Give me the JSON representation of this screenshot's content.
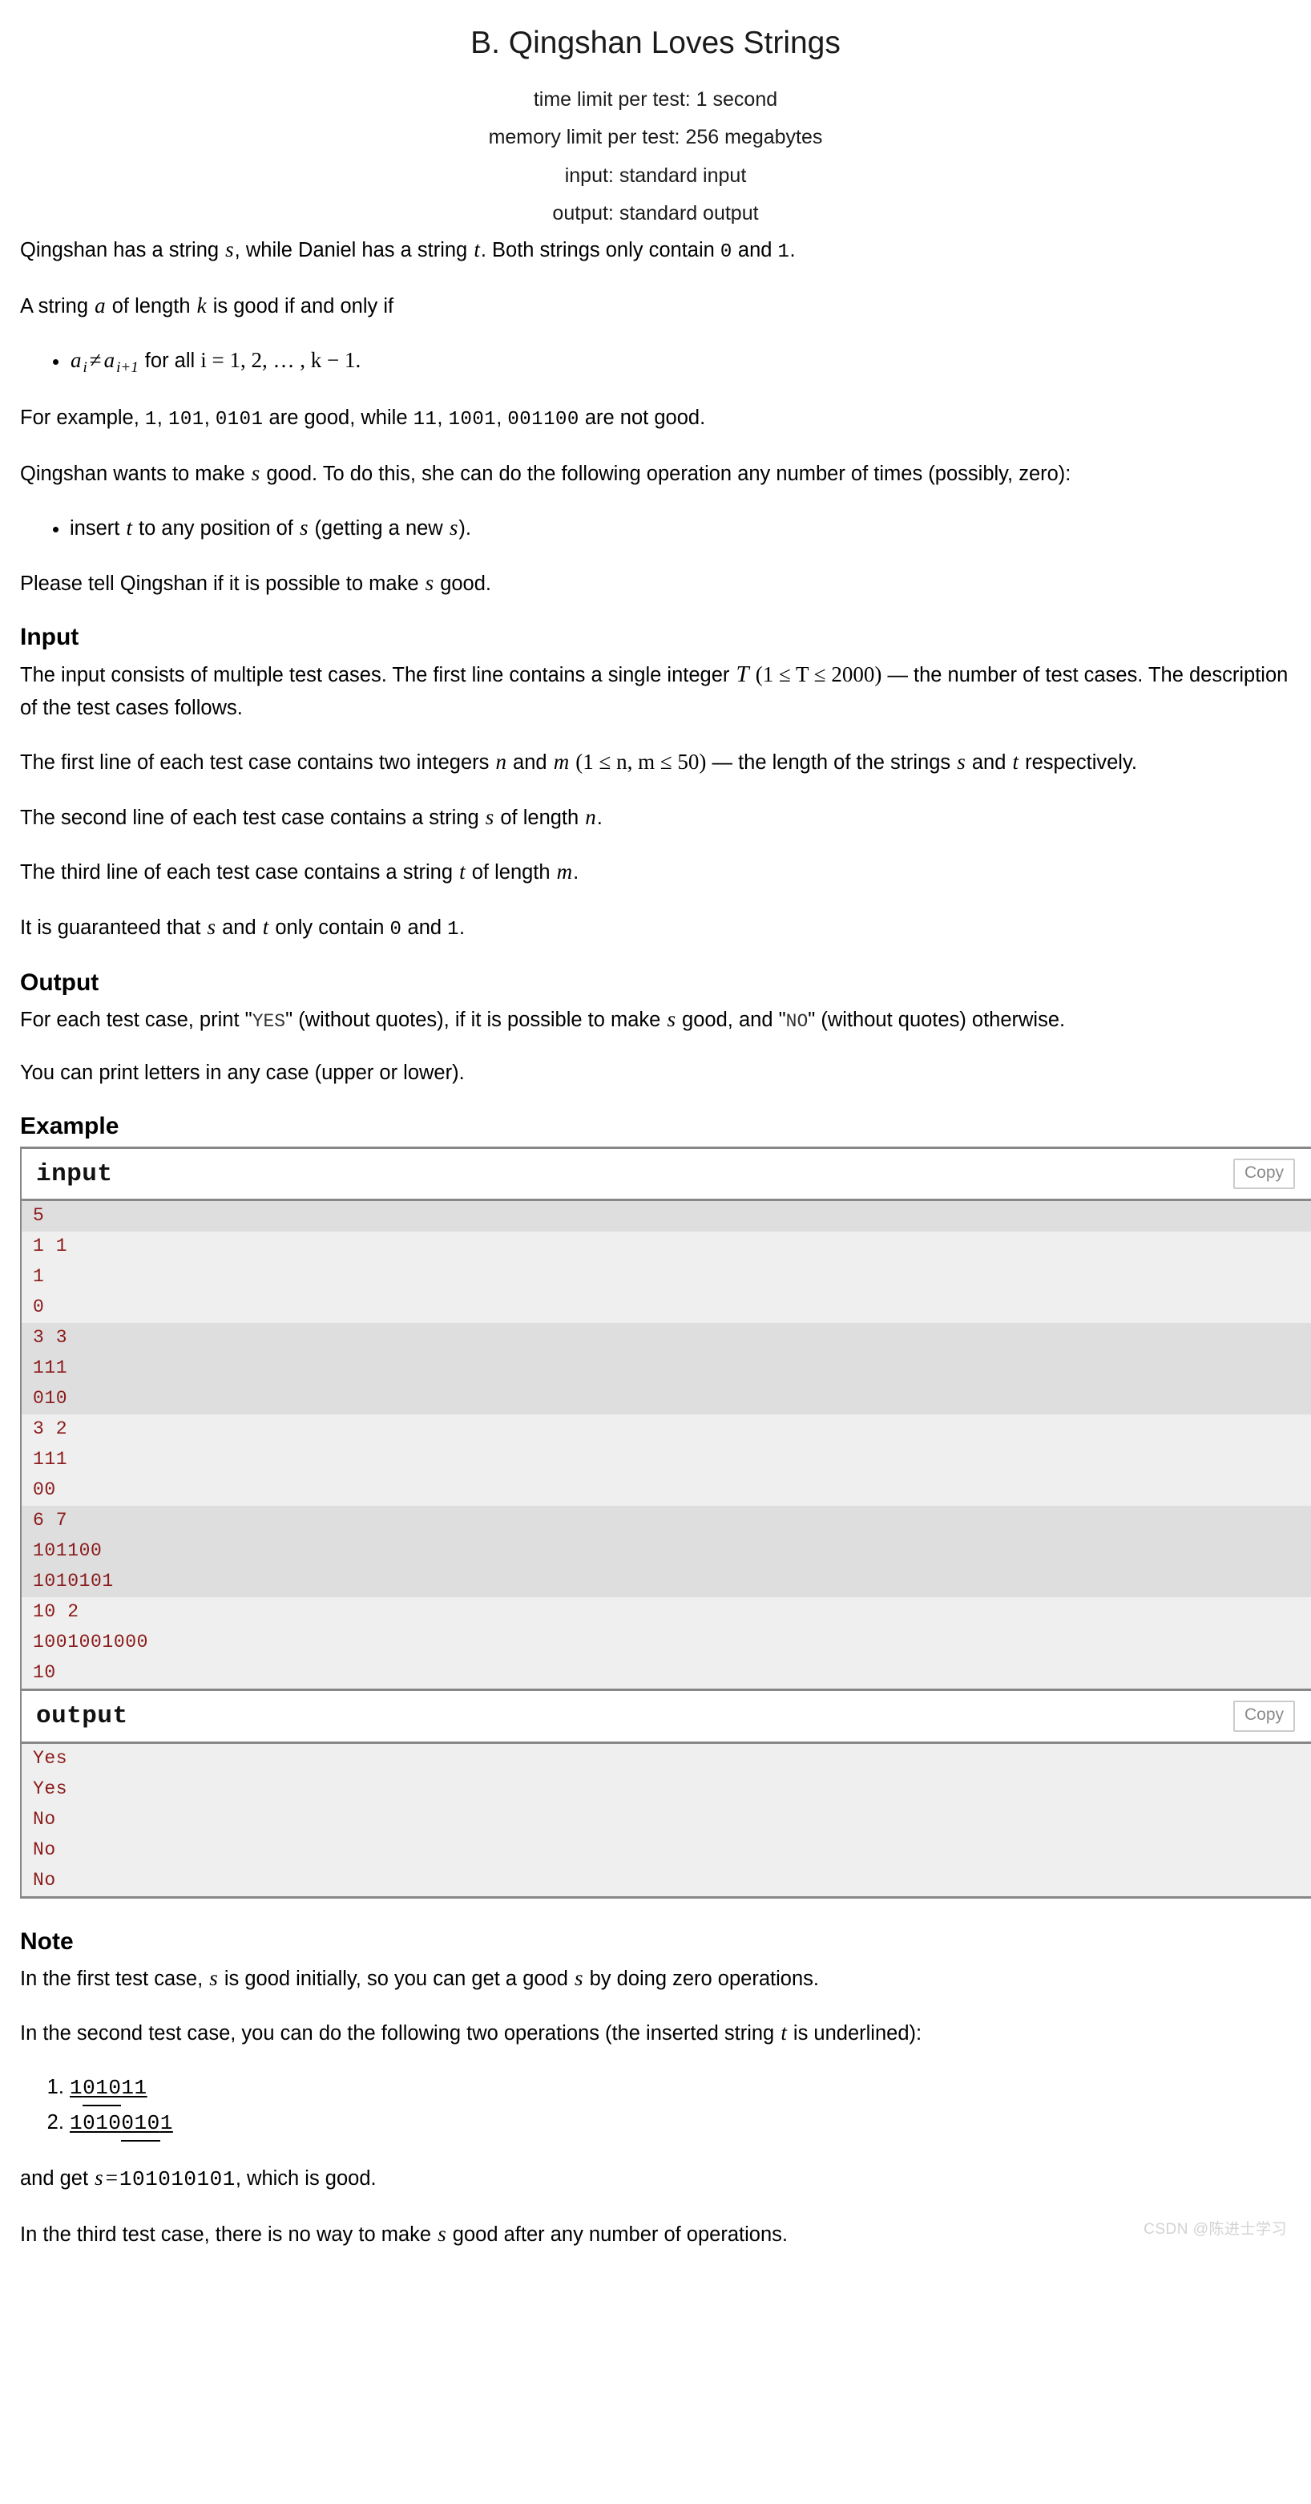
{
  "header": {
    "title": "B. Qingshan Loves Strings",
    "time_limit": "time limit per test: 1 second",
    "memory_limit": "memory limit per test: 256 megabytes",
    "input_spec": "input: standard input",
    "output_spec": "output: standard output"
  },
  "statement": {
    "p1_a": "Qingshan has a string ",
    "p1_s": "s",
    "p1_b": ", while Daniel has a string ",
    "p1_t": "t",
    "p1_c": ". Both strings only contain ",
    "p1_zero": "0",
    "p1_d": " and ",
    "p1_one": "1",
    "p1_e": ".",
    "p2_a": "A string ",
    "p2_a_var": "a",
    "p2_b": " of length ",
    "p2_k": "k",
    "p2_c": " is good if and only if",
    "bullet1_ai": "a",
    "bullet1_sub_i": "i",
    "bullet1_neq": "≠",
    "bullet1_ai1": "a",
    "bullet1_sub_i1": "i+1",
    "bullet1_rest": " for all ",
    "bullet1_range": "i = 1, 2, … , k − 1.",
    "p3_a": "For example, ",
    "p3_good1": "1",
    "p3_sep1": ", ",
    "p3_good2": "101",
    "p3_sep2": ", ",
    "p3_good3": "0101",
    "p3_mid": " are good, while ",
    "p3_bad1": "11",
    "p3_sep3": ", ",
    "p3_bad2": "1001",
    "p3_sep4": ", ",
    "p3_bad3": "001100",
    "p3_end": " are not good.",
    "p4_a": "Qingshan wants to make ",
    "p4_s": "s",
    "p4_b": " good. To do this, she can do the following operation any number of times (possibly, zero):",
    "bullet2_a": "insert ",
    "bullet2_t": "t",
    "bullet2_b": " to any position of ",
    "bullet2_s": "s",
    "bullet2_c": " (getting a new ",
    "bullet2_s2": "s",
    "bullet2_d": ").",
    "p5_a": "Please tell Qingshan if it is possible to make ",
    "p5_s": "s",
    "p5_b": " good."
  },
  "input_section": {
    "heading": "Input",
    "p1_a": "The input consists of multiple test cases. The first line contains a single integer ",
    "p1_T": "T",
    "p1_constraint": "(1 ≤ T ≤ 2000)",
    "p1_b": " — the number of test cases. The description of the test cases follows.",
    "p2_a": "The first line of each test case contains two integers ",
    "p2_n": "n",
    "p2_and": " and ",
    "p2_m": "m",
    "p2_constraint": "(1 ≤ n, m ≤ 50)",
    "p2_b": " — the length of the strings ",
    "p2_s": "s",
    "p2_and2": " and ",
    "p2_t": "t",
    "p2_c": " respectively.",
    "p3_a": "The second line of each test case contains a string ",
    "p3_s": "s",
    "p3_b": " of length ",
    "p3_n": "n",
    "p3_c": ".",
    "p4_a": "The third line of each test case contains a string ",
    "p4_t": "t",
    "p4_b": " of length ",
    "p4_m": "m",
    "p4_c": ".",
    "p5_a": "It is guaranteed that ",
    "p5_s": "s",
    "p5_and": " and ",
    "p5_t": "t",
    "p5_b": " only contain ",
    "p5_zero": "0",
    "p5_c": " and ",
    "p5_one": "1",
    "p5_d": "."
  },
  "output_section": {
    "heading": "Output",
    "p1_a": "For each test case, print \"",
    "p1_yes": "YES",
    "p1_b": "\" (without quotes), if it is possible to make ",
    "p1_s": "s",
    "p1_c": " good, and \"",
    "p1_no": "NO",
    "p1_d": "\" (without quotes) otherwise.",
    "p2": "You can print letters in any case (upper or lower)."
  },
  "example_section": {
    "heading": "Example",
    "input_label": "input",
    "output_label": "output",
    "copy_label": "Copy",
    "input_groups": [
      {
        "shaded": true,
        "lines": [
          "5"
        ]
      },
      {
        "shaded": false,
        "lines": [
          "1 1",
          "1",
          "0"
        ]
      },
      {
        "shaded": true,
        "lines": [
          "3 3",
          "111",
          "010"
        ]
      },
      {
        "shaded": false,
        "lines": [
          "3 2",
          "111",
          "00"
        ]
      },
      {
        "shaded": true,
        "lines": [
          "6 7",
          "101100",
          "1010101"
        ]
      },
      {
        "shaded": false,
        "lines": [
          "10 2",
          "1001001000",
          "10"
        ]
      }
    ],
    "output_groups": [
      {
        "shaded": false,
        "lines": [
          "Yes",
          "Yes",
          "No",
          "No",
          "No"
        ]
      }
    ]
  },
  "note_section": {
    "heading": "Note",
    "p1_a": "In the first test case, ",
    "p1_s": "s",
    "p1_b": " is good initially, so you can get a good ",
    "p1_s2": "s",
    "p1_c": " by doing zero operations.",
    "p2_a": "In the second test case, you can do the following two operations (the inserted string ",
    "p2_t": "t",
    "p2_b": " is underlined):",
    "steps": [
      {
        "prefix": "1",
        "inserted": "010",
        "suffix": "11"
      },
      {
        "prefix": "1010",
        "inserted": "010",
        "suffix": "1"
      }
    ],
    "p3_a": "and get ",
    "p3_s": "s",
    "p3_eq": "=",
    "p3_val": "101010101",
    "p3_b": ", which is good.",
    "p4": "In the third test case, there is no way to make s good after any number of operations.",
    "p4_a": "In the third test case, there is no way to make ",
    "p4_s": "s",
    "p4_b": " good after any number of operations."
  },
  "watermark": {
    "text": "CSDN @陈进士学习"
  }
}
